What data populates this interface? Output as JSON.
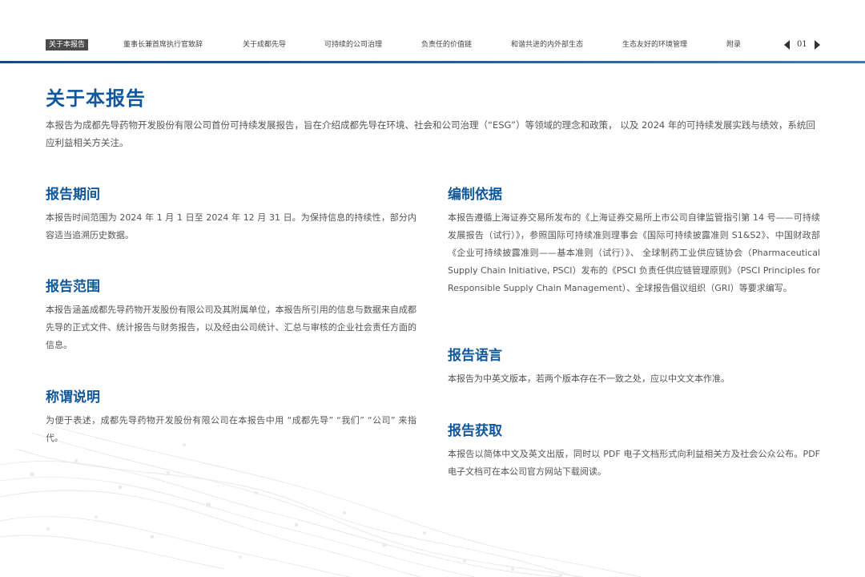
{
  "nav": {
    "items": [
      {
        "label": "关于本报告",
        "active": true
      },
      {
        "label": "董事长兼首席执行官致辞",
        "active": false
      },
      {
        "label": "关于成都先导",
        "active": false
      },
      {
        "label": "可持续的公司治理",
        "active": false
      },
      {
        "label": "负责任的价值链",
        "active": false
      },
      {
        "label": "和谐共进的内外部生态",
        "active": false
      },
      {
        "label": "生态友好的环境管理",
        "active": false
      },
      {
        "label": "附录",
        "active": false
      }
    ],
    "page_number": "01",
    "prev_icon": "caret-left-icon",
    "next_icon": "caret-right-icon"
  },
  "colors": {
    "accent": "#11579b",
    "body_text": "#555555",
    "active_nav_bg": "#4a4a4a"
  },
  "page": {
    "title": "关于本报告",
    "intro": "本报告为成都先导药物开发股份有限公司首份可持续发展报告，旨在介绍成都先导在环境、社会和公司治理（“ESG”）等领域的理念和政策， 以及 2024 年的可持续发展实践与绩效，系统回应利益相关方关注。"
  },
  "sections": {
    "period": {
      "title": "报告期间",
      "body": "本报告时间范围为 2024 年 1 月 1 日至 2024 年 12 月 31 日。为保持信息的持续性，部分内容适当追溯历史数据。"
    },
    "scope": {
      "title": "报告范围",
      "body": "本报告涵盖成都先导药物开发股份有限公司及其附属单位，本报告所引用的信息与数据来自成都先导的正式文件、统计报告与财务报告，以及经由公司统计、汇总与审核的企业社会责任方面的信息。"
    },
    "terms": {
      "title": "称谓说明",
      "body": "为便于表述，成都先导药物开发股份有限公司在本报告中用 “成都先导” “我们” “公司” 来指代。"
    },
    "basis": {
      "title": "编制依据",
      "body": "本报告遵循上海证券交易所发布的《上海证券交易所上市公司自律监管指引第 14 号——可持续发展报告（试行）》，参照国际可持续准则理事会《国际可持续披露准则 S1&S2》、中国财政部《企业可持续披露准则——基本准则（试行）》、 全球制药工业供应链协会（Pharmaceutical Supply Chain Initiative, PSCI）发布的《PSCI 负责任供应链管理原则》（PSCI Principles for Responsible Supply Chain Management）、全球报告倡议组织（GRI）等要求编写。"
    },
    "language": {
      "title": "报告语言",
      "body": "本报告为中英文版本，若两个版本存在不一致之处，应以中文文本作准。"
    },
    "access": {
      "title": "报告获取",
      "body": "本报告以简体中文及英文出版，同时以 PDF 电子文档形式向利益相关方及社会公众公布。PDF 电子文档可在本公司官方网站下载阅读。"
    }
  }
}
